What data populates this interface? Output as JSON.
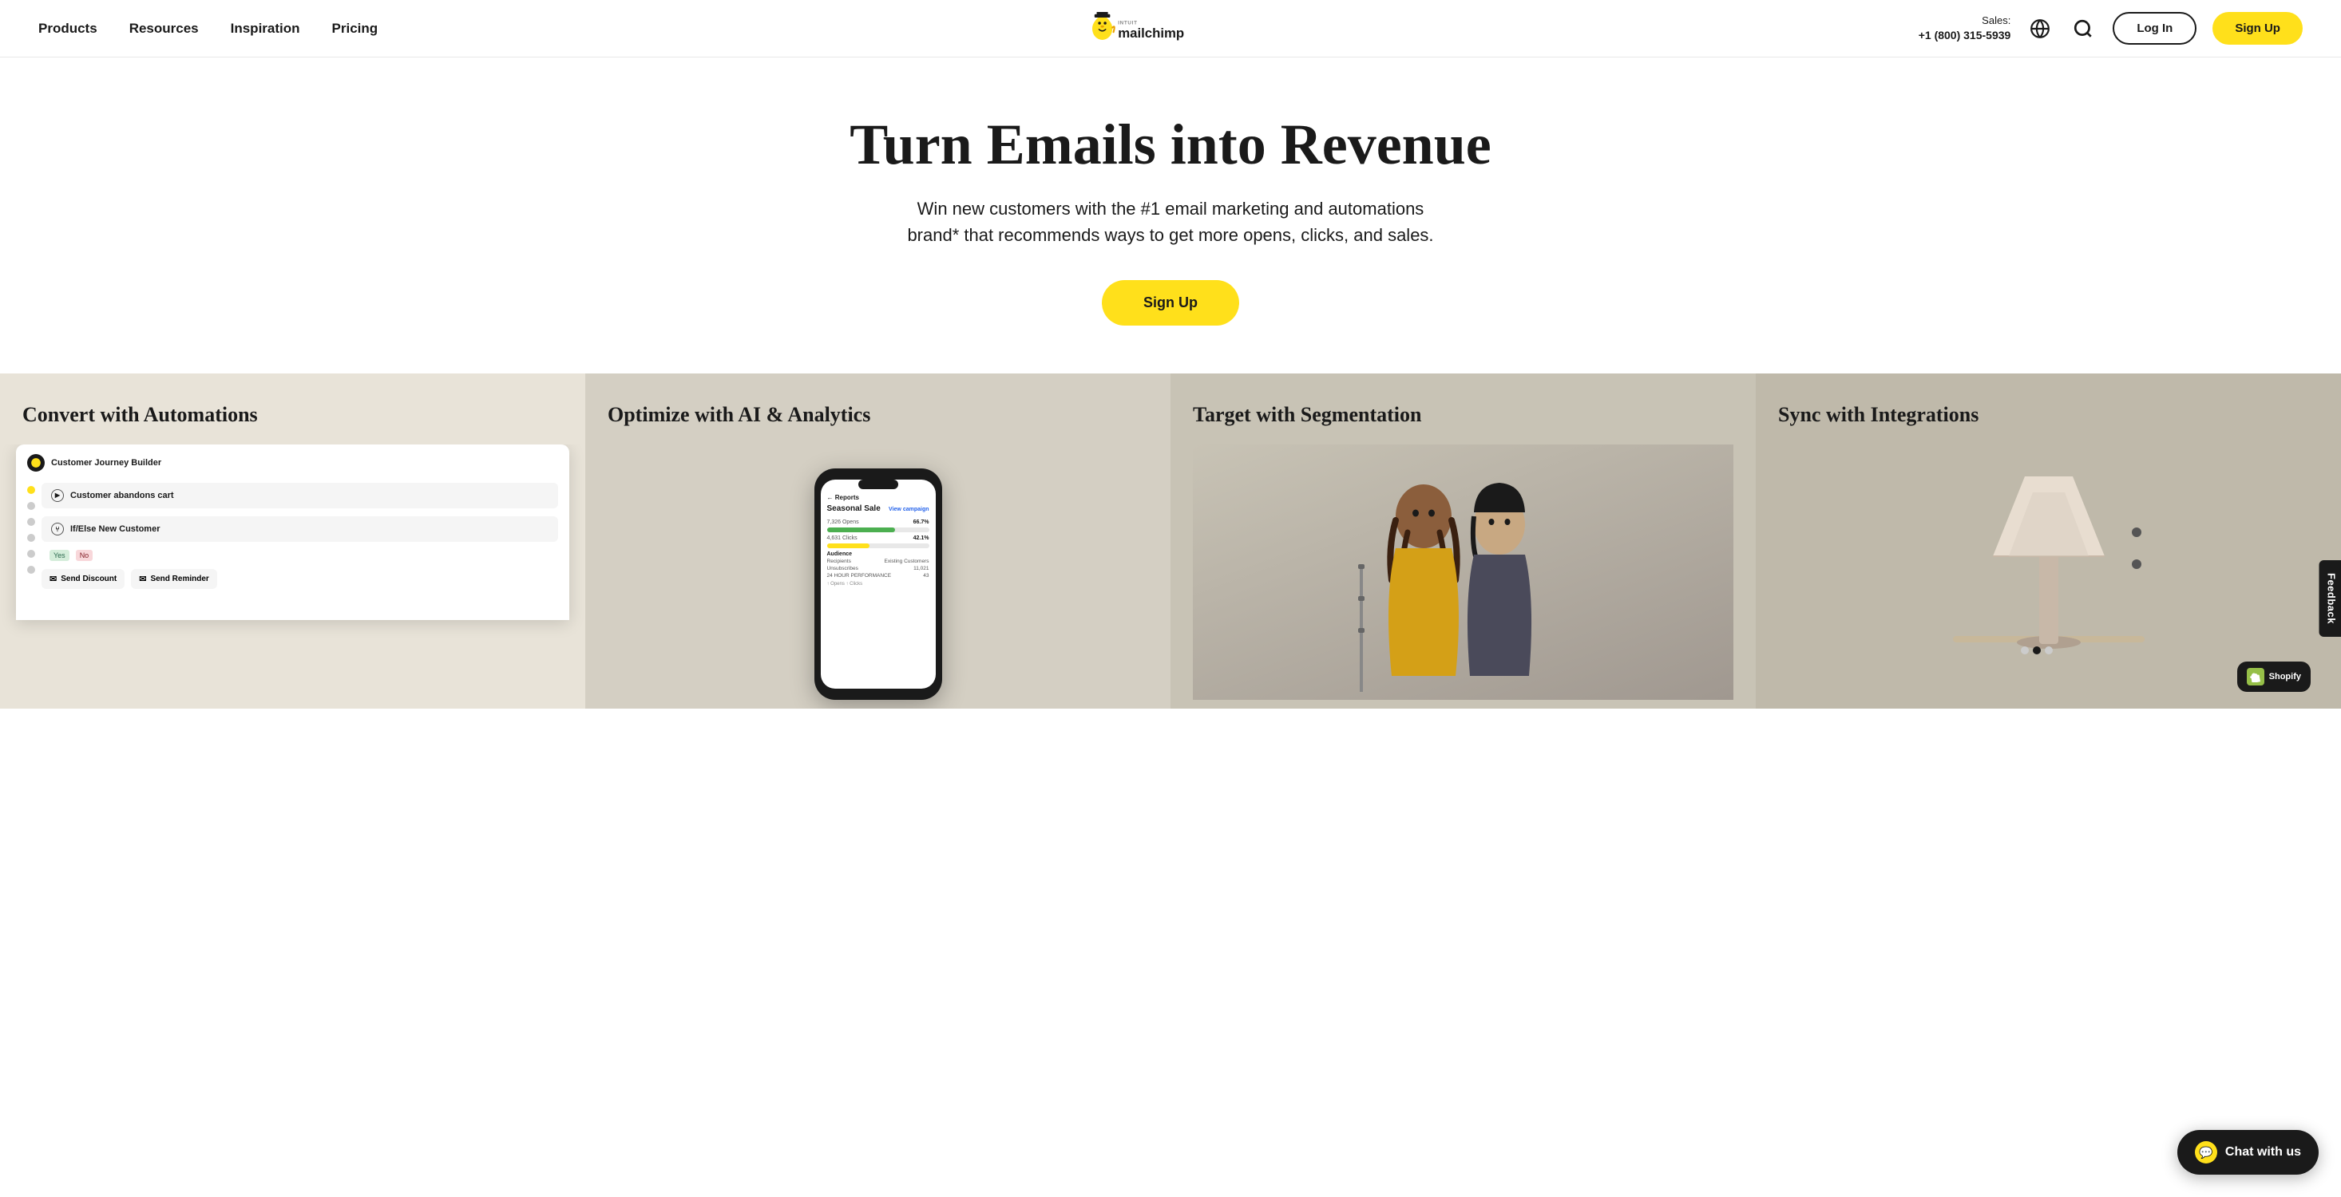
{
  "nav": {
    "links": [
      {
        "id": "products",
        "label": "Products"
      },
      {
        "id": "resources",
        "label": "Resources"
      },
      {
        "id": "inspiration",
        "label": "Inspiration"
      },
      {
        "id": "pricing",
        "label": "Pricing"
      }
    ],
    "sales_label": "Sales:",
    "sales_phone": "+1 (800) 315-5939",
    "login_label": "Log In",
    "signup_label": "Sign Up"
  },
  "hero": {
    "title": "Turn Emails into Revenue",
    "subtitle": "Win new customers with the #1 email marketing and automations brand* that recommends ways to get more opens, clicks, and sales.",
    "cta": "Sign Up"
  },
  "features": [
    {
      "id": "automations",
      "title": "Convert with Automations",
      "journey_header": "Customer Journey Builder",
      "step1": "Customer abandons cart",
      "step2": "If/Else New Customer",
      "send1": "Send Discount",
      "send2": "Send Reminder"
    },
    {
      "id": "ai-analytics",
      "title": "Optimize with AI & Analytics",
      "campaign_title": "Seasonal Sale",
      "view_campaign": "View campaign",
      "stat1_label": "Opens",
      "stat1_value": "7,326 Opens",
      "stat1_pct": "66.7%",
      "stat2_label": "Clicks",
      "stat2_value": "4,631 Clicks",
      "stat2_pct": "42.1%",
      "section_label": "Audience",
      "col1": "Recipients",
      "col2": "Existing Customers",
      "col3": "Unsubscribes",
      "col4": "24 HOUR PERFORMANCE",
      "val1": "",
      "val2": "11,021",
      "val3": "43"
    },
    {
      "id": "segmentation",
      "title": "Target with Segmentation"
    },
    {
      "id": "integrations",
      "title": "Sync with Integrations",
      "shopify_label": "Shopify"
    }
  ],
  "chat": {
    "label": "Chat with us"
  },
  "feedback": {
    "label": "Feedback"
  }
}
